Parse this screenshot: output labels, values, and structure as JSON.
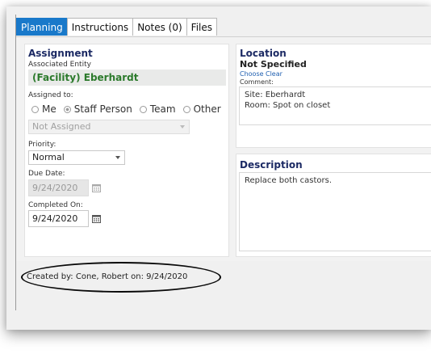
{
  "tabs": [
    "Planning",
    "Instructions",
    "Notes (0)",
    "Files"
  ],
  "assignment": {
    "title": "Assignment",
    "associated_label": "Associated Entity",
    "entity": "(Facility) Eberhardt",
    "assigned_to_label": "Assigned to:",
    "options": [
      "Me",
      "Staff Person",
      "Team",
      "Other"
    ],
    "selected_option": "Staff Person",
    "staff_select": "Not Assigned",
    "priority_label": "Priority:",
    "priority_value": "Normal",
    "due_label": "Due Date:",
    "due_value": "9/24/2020",
    "completed_label": "Completed On:",
    "completed_value": "9/24/2020"
  },
  "location": {
    "title": "Location",
    "status": "Not Specified",
    "choose": "Choose",
    "clear": "Clear",
    "comment_label": "Comment:",
    "comment_lines": [
      "Site: Eberhardt",
      "Room: Spot on closet"
    ]
  },
  "description": {
    "title": "Description",
    "text": "Replace both castors."
  },
  "footer": {
    "created_by": "Created by: Cone, Robert on: 9/24/2020"
  }
}
